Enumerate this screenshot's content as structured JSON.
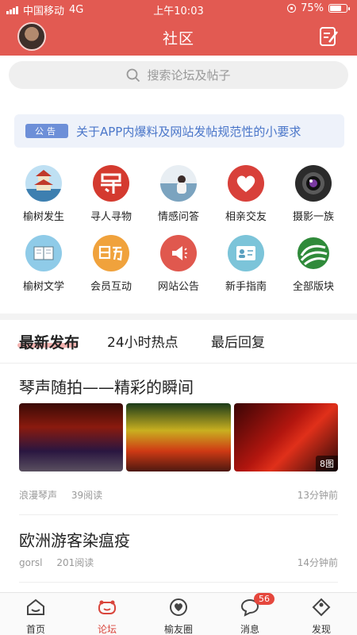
{
  "status_bar": {
    "carrier": "中国移动",
    "network": "4G",
    "time": "上午10:03",
    "battery": "75%",
    "battery_level": 0.75
  },
  "header": {
    "title": "社区",
    "avatar_icon": "user-avatar",
    "edit_icon": "edit-note-icon"
  },
  "search": {
    "placeholder": "搜索论坛及帖子",
    "icon": "search-icon"
  },
  "notice": {
    "tag": "公告",
    "text": "关于APP内爆料及网站发帖规范性的小要求"
  },
  "forums": [
    {
      "label": "榆树发生",
      "icon": "pavilion-icon"
    },
    {
      "label": "寻人寻物",
      "icon": "search-person-icon"
    },
    {
      "label": "情感问答",
      "icon": "emotion-icon"
    },
    {
      "label": "相亲交友",
      "icon": "heart-icon"
    },
    {
      "label": "摄影一族",
      "icon": "camera-icon"
    },
    {
      "label": "榆树文学",
      "icon": "book-icon"
    },
    {
      "label": "会员互动",
      "icon": "interact-icon"
    },
    {
      "label": "网站公告",
      "icon": "megaphone-icon"
    },
    {
      "label": "新手指南",
      "icon": "id-card-icon"
    },
    {
      "label": "全部版块",
      "icon": "all-sections-icon"
    }
  ],
  "tabs": [
    {
      "label": "最新发布",
      "active": true
    },
    {
      "label": "24小时热点",
      "active": false
    },
    {
      "label": "最后回复",
      "active": false
    }
  ],
  "posts": [
    {
      "title": "琴声随拍——精彩的瞬间",
      "author": "浪漫琴声",
      "reads": "39阅读",
      "time": "13分钟前",
      "image_count": "8图"
    },
    {
      "title": "欧洲游客染瘟疫",
      "author": "gorsl",
      "reads": "201阅读",
      "time": "14分钟前"
    }
  ],
  "bottom_nav": [
    {
      "label": "首页",
      "icon": "home-icon",
      "active": false
    },
    {
      "label": "论坛",
      "icon": "forum-icon",
      "active": true
    },
    {
      "label": "榆友圈",
      "icon": "friends-heart-icon",
      "active": false
    },
    {
      "label": "消息",
      "icon": "message-icon",
      "active": false,
      "badge": "56"
    },
    {
      "label": "发现",
      "icon": "discover-tag-icon",
      "active": false
    }
  ],
  "colors": {
    "brand_red": "#e25a52",
    "notice_blue": "#4a76c9",
    "active_red": "#d9453c"
  }
}
